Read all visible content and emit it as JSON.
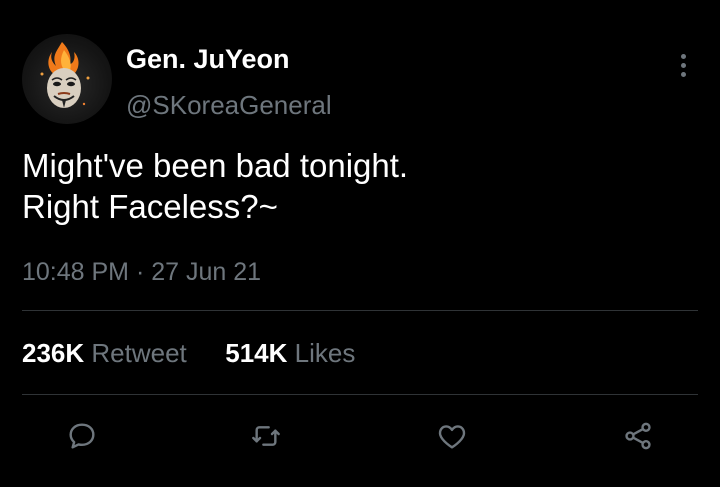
{
  "tweet": {
    "author": {
      "display_name": "Gen. JuYeon",
      "handle": "@SKoreaGeneral",
      "avatar_icon": "masked-face-flame-avatar"
    },
    "text_lines": [
      "Might've been bad tonight.",
      "Right Faceless?~"
    ],
    "time": "10:48 PM",
    "separator": "·",
    "date": "27 Jun 21",
    "stats": {
      "retweets_count": "236K",
      "retweets_label": "Retweet",
      "likes_count": "514K",
      "likes_label": "Likes"
    },
    "actions": [
      {
        "name": "reply",
        "icon": "reply-icon"
      },
      {
        "name": "retweet",
        "icon": "retweet-icon"
      },
      {
        "name": "like",
        "icon": "heart-icon"
      },
      {
        "name": "share",
        "icon": "share-icon"
      }
    ]
  },
  "colors": {
    "background": "#000000",
    "primary_text": "#ffffff",
    "secondary_text": "#6e767d",
    "divider": "#2f3336"
  }
}
